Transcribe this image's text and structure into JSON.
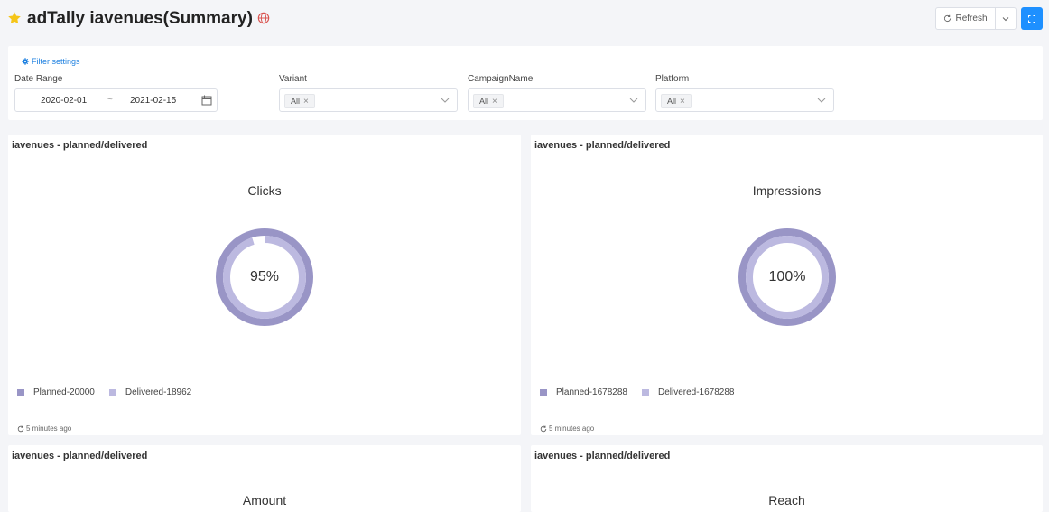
{
  "header": {
    "title": "adTally iavenues(Summary)",
    "refresh_label": "Refresh"
  },
  "filters": {
    "settings_label": "Filter settings",
    "date_range": {
      "label": "Date Range",
      "start": "2020-02-01",
      "separator": "~",
      "end": "2021-02-15"
    },
    "variant": {
      "label": "Variant",
      "tag": "All"
    },
    "campaign": {
      "label": "CampaignName",
      "tag": "All"
    },
    "platform": {
      "label": "Platform",
      "tag": "All"
    }
  },
  "cards": [
    {
      "title": "iavenues - planned/delivered",
      "metric": "Clicks",
      "percent_text": "95%",
      "delivered_fraction": 0.95,
      "legend": [
        "Planned-20000",
        "Delivered-18962"
      ],
      "updated": "5 minutes ago"
    },
    {
      "title": "iavenues - planned/delivered",
      "metric": "Impressions",
      "percent_text": "100%",
      "delivered_fraction": 1.0,
      "legend": [
        "Planned-1678288",
        "Delivered-1678288"
      ],
      "updated": "5 minutes ago"
    },
    {
      "title": "iavenues - planned/delivered",
      "metric": "Amount"
    },
    {
      "title": "iavenues - planned/delivered",
      "metric": "Reach"
    }
  ],
  "colors": {
    "planned": "#9995c6",
    "delivered": "#bcb9e0",
    "accent": "#1e90ff",
    "star": "#f5c518",
    "globe": "#d9534f"
  }
}
